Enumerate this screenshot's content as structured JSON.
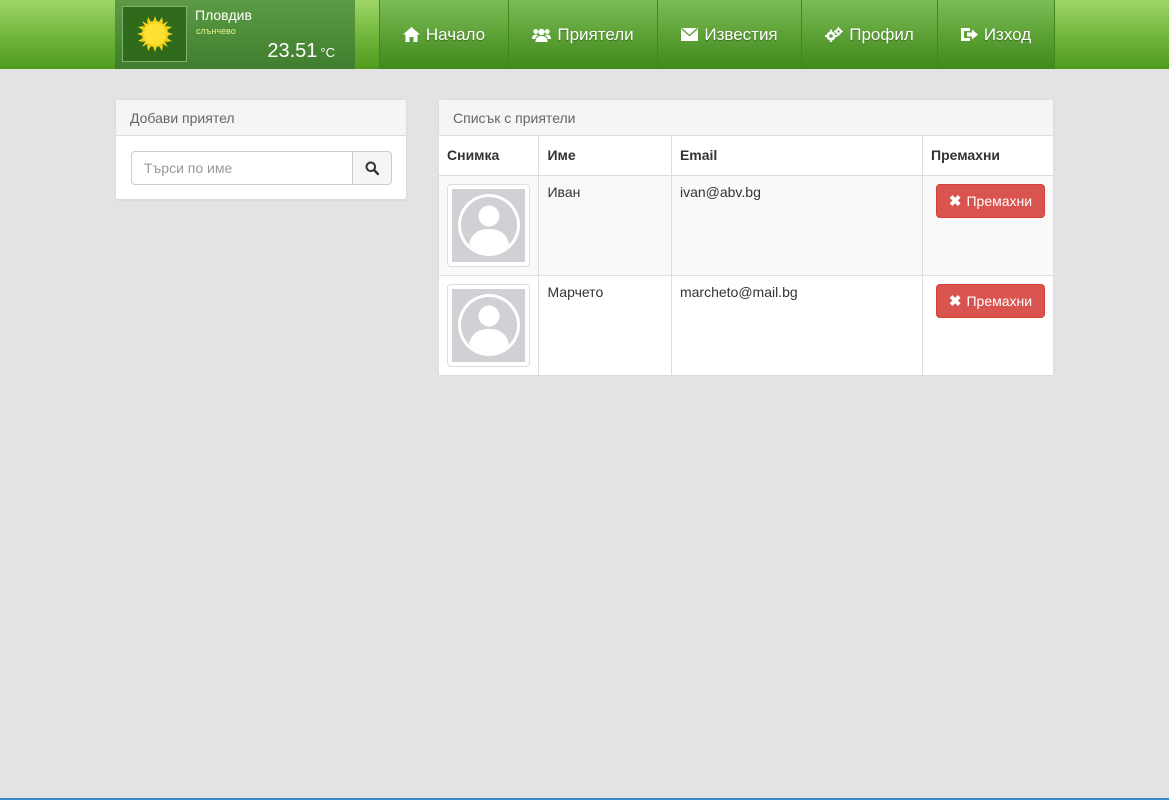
{
  "weather": {
    "city": "Пловдив",
    "description": "слънчево",
    "temperature": "23.51",
    "unit": "°C",
    "icon": "sun-icon"
  },
  "nav": {
    "items": [
      {
        "label": "Начало",
        "icon": "home-icon"
      },
      {
        "label": "Приятели",
        "icon": "users-icon"
      },
      {
        "label": "Известия",
        "icon": "envelope-icon"
      },
      {
        "label": "Профил",
        "icon": "gears-icon"
      },
      {
        "label": "Изход",
        "icon": "logout-icon"
      }
    ]
  },
  "add_friend": {
    "title": "Добави приятел",
    "search_placeholder": "Търси по име",
    "search_icon": "search-icon"
  },
  "friends": {
    "title": "Списък с приятели",
    "columns": [
      "Снимка",
      "Име",
      "Email",
      "Премахни"
    ],
    "rows": [
      {
        "name": "Иван",
        "email": "ivan@abv.bg",
        "remove_label": "Премахни"
      },
      {
        "name": "Марчето",
        "email": "marcheto@mail.bg",
        "remove_label": "Премахни"
      }
    ]
  },
  "colors": {
    "brand_green": "#6fb43a",
    "danger": "#d9534f",
    "background": "#e3e3e3"
  }
}
